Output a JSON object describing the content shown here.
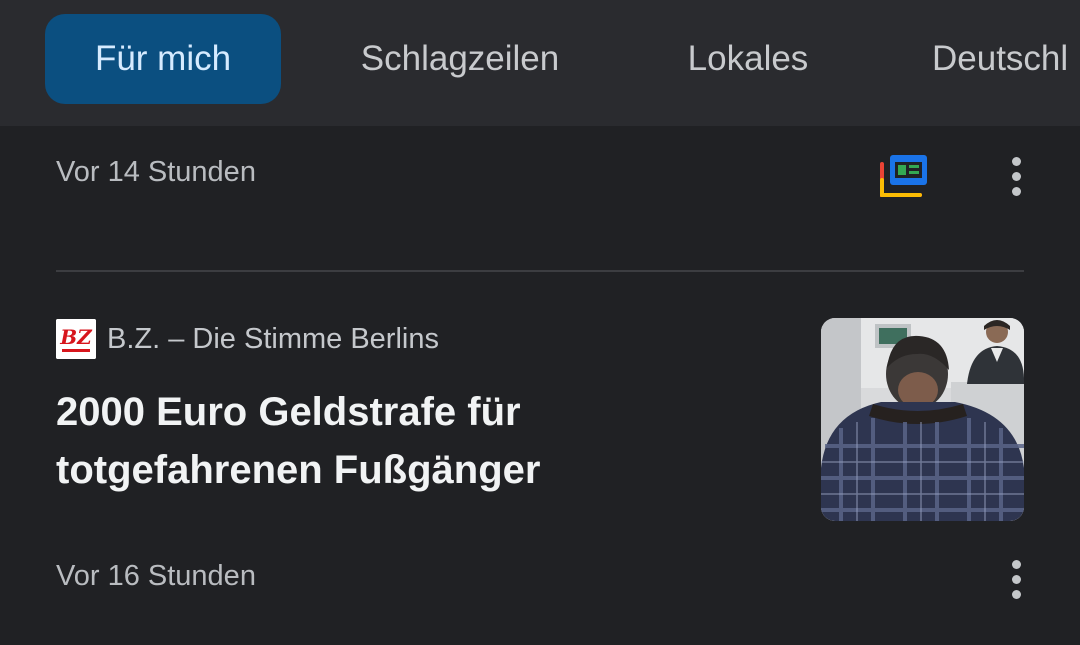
{
  "tabs": [
    {
      "label": "Für mich",
      "active": true
    },
    {
      "label": "Schlagzeilen",
      "active": false
    },
    {
      "label": "Lokales",
      "active": false
    },
    {
      "label": "Deutschl",
      "active": false
    }
  ],
  "cards": [
    {
      "time": "Vor 14 Stunden",
      "icons": [
        "newscast-icon",
        "more-vert-icon"
      ]
    },
    {
      "source": {
        "name": "B.Z. – Die Stimme Berlins",
        "logo_text": "BZ"
      },
      "headline": "2000 Euro Geldstrafe für totgefahrenen Fußgänger",
      "time": "Vor 16 Stunden",
      "thumbnail": "courtroom-photo",
      "icons": [
        "more-vert-icon"
      ]
    }
  ],
  "colors": {
    "background": "#202124",
    "tabbar": "#2a2b2f",
    "active_tab": "#0b4f80",
    "active_tab_text": "#d6ebff",
    "divider": "#3c3d41"
  }
}
